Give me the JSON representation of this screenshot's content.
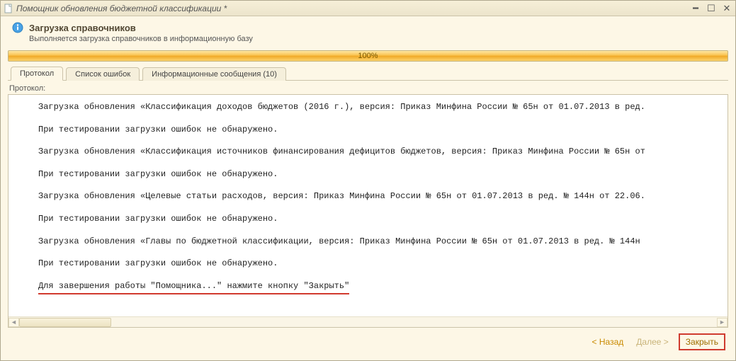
{
  "window": {
    "title": "Помощник обновления бюджетной классификации *"
  },
  "header": {
    "title": "Загрузка справочников",
    "subtitle": "Выполняется загрузка справочников в информационную базу"
  },
  "progress": {
    "text": "100%"
  },
  "tabs": [
    {
      "label": "Протокол",
      "active": true
    },
    {
      "label": "Список ошибок",
      "active": false
    },
    {
      "label": "Информационные сообщения (10)",
      "active": false
    }
  ],
  "protocol": {
    "section_label": "Протокол:",
    "lines": [
      "Загрузка обновления «Классификация доходов бюджетов (2016 г.), версия: Приказ Минфина России № 65н от 01.07.2013 в ред.",
      "При тестировании загрузки ошибок не обнаружено.",
      "Загрузка обновления «Классификация источников финансирования дефицитов бюджетов, версия: Приказ Минфина России № 65н от",
      "При тестировании загрузки ошибок не обнаружено.",
      "Загрузка обновления «Целевые статьи расходов, версия: Приказ Минфина России № 65н от 01.07.2013 в ред. № 144н от 22.06.",
      "При тестировании загрузки ошибок не обнаружено.",
      "Загрузка обновления «Главы по бюджетной классификации, версия: Приказ Минфина России № 65н от 01.07.2013 в ред. № 144н",
      "При тестировании загрузки ошибок не обнаружено.",
      "Для завершения работы \"Помощника...\" нажмите кнопку \"Закрыть\""
    ]
  },
  "footer": {
    "back": "< Назад",
    "next": "Далее >",
    "close": "Закрыть"
  }
}
